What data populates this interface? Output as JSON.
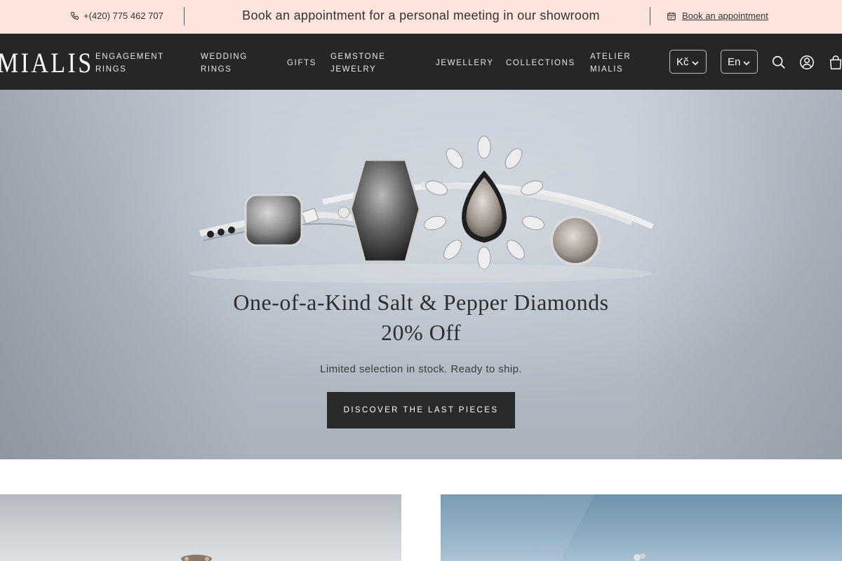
{
  "topbar": {
    "phone": "+(420) 775 462 707",
    "promo": "Book an appointment for a personal meeting in our showroom",
    "book_link": "Book an appointment"
  },
  "header": {
    "logo": "MIALIS",
    "nav": [
      {
        "line1": "ENGAGEMENT",
        "line2": "RINGS"
      },
      {
        "line1": "WEDDING",
        "line2": "RINGS"
      },
      {
        "line1": "GIFTS",
        "line2": ""
      },
      {
        "line1": "GEMSTONE",
        "line2": "JEWELRY"
      },
      {
        "line1": "JEWELLERY",
        "line2": ""
      },
      {
        "line1": "COLLECTIONS",
        "line2": ""
      },
      {
        "line1": "ATELIER",
        "line2": "MIALIS"
      }
    ],
    "currency": "Kč",
    "language": "En",
    "icons": [
      "search-icon",
      "account-icon",
      "cart-icon"
    ]
  },
  "hero": {
    "title_line1": "One-of-a-Kind Salt & Pepper Diamonds",
    "title_line2": "20% Off",
    "subtitle": "Limited selection in stock. Ready to ship.",
    "cta": "DISCOVER THE LAST PIECES"
  },
  "colors": {
    "topbar_bg": "#fde4dd",
    "header_bg": "#262626",
    "cta_bg": "#2a2a2a"
  }
}
